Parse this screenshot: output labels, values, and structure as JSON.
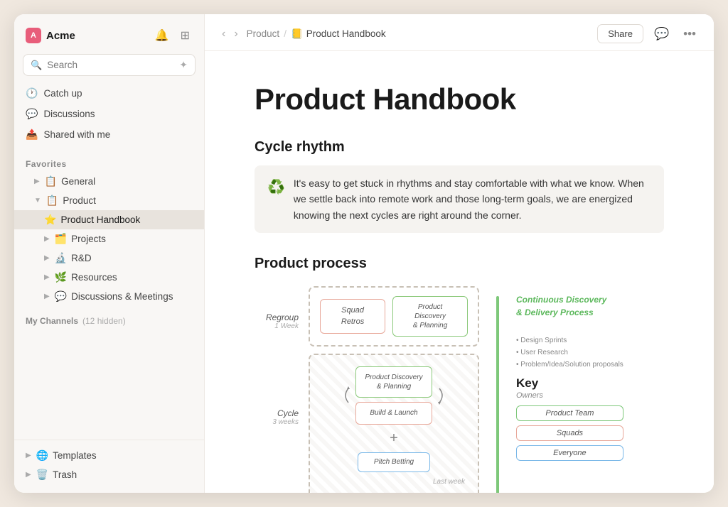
{
  "workspace": {
    "name": "Acme",
    "icon_letter": "A"
  },
  "sidebar": {
    "search_placeholder": "Search",
    "nav_items": [
      {
        "id": "catchup",
        "icon": "🕐",
        "label": "Catch up"
      },
      {
        "id": "discussions",
        "icon": "💬",
        "label": "Discussions"
      },
      {
        "id": "shared",
        "icon": "📤",
        "label": "Shared with me"
      }
    ],
    "favorites_label": "Favorites",
    "favorites_items": [
      {
        "id": "general",
        "icon": "📋",
        "label": "General",
        "indent": 1,
        "has_chevron": true
      },
      {
        "id": "product",
        "icon": "📋",
        "label": "Product",
        "indent": 1,
        "has_chevron": true,
        "expanded": true
      },
      {
        "id": "product-handbook",
        "icon": "⭐",
        "label": "Product Handbook",
        "indent": 2,
        "active": true
      },
      {
        "id": "projects",
        "icon": "🗂️",
        "label": "Projects",
        "indent": 2,
        "has_chevron": true
      },
      {
        "id": "rnd",
        "icon": "🔬",
        "label": "R&D",
        "indent": 2,
        "has_chevron": true
      },
      {
        "id": "resources",
        "icon": "🌿",
        "label": "Resources",
        "indent": 2,
        "has_chevron": true
      },
      {
        "id": "discussions-meetings",
        "icon": "💬",
        "label": "Discussions & Meetings",
        "indent": 2,
        "has_chevron": true
      }
    ],
    "channels_label": "My Channels",
    "channels_hidden": "(12 hidden)",
    "bottom_items": [
      {
        "id": "templates",
        "icon": "🌐",
        "label": "Templates",
        "has_chevron": true
      },
      {
        "id": "trash",
        "icon": "🗑️",
        "label": "Trash",
        "has_chevron": true
      }
    ]
  },
  "topbar": {
    "breadcrumb_parent": "Product",
    "breadcrumb_separator": "/",
    "breadcrumb_icon": "📒",
    "breadcrumb_current": "Product Handbook",
    "share_label": "Share",
    "back_arrow": "‹",
    "forward_arrow": "›"
  },
  "page": {
    "title": "Product Handbook",
    "cycle_rhythm": {
      "section_title": "Cycle rhythm",
      "callout_icon": "♻️",
      "callout_text": "It's easy to get stuck in rhythms and stay comfortable with what we know. When we settle back into remote work and those long-term goals, we are energized knowing the next cycles are right around the corner."
    },
    "product_process": {
      "section_title": "Product process",
      "regroup_label": "Regroup",
      "regroup_duration": "1 Week",
      "squad_retros_label": "Squad Retros",
      "discovery_planning_label": "Product Discovery & Planning",
      "cycle_label": "Cycle",
      "cycle_duration": "3 weeks",
      "build_launch_label": "Build & Launch",
      "pitch_betting_label": "Pitch Betting",
      "last_week_label": "Last week",
      "continuous_label": "Continuous Discovery & Delivery Process",
      "key_title": "Key",
      "key_owners_label": "Owners",
      "key_items": [
        {
          "label": "Product Team",
          "color": "green"
        },
        {
          "label": "Squads",
          "color": "red"
        },
        {
          "label": "Everyone",
          "color": "blue"
        }
      ],
      "notes": [
        "• Design Sprints",
        "• User Research",
        "• Problem/Idea/Solution proposals"
      ]
    }
  }
}
